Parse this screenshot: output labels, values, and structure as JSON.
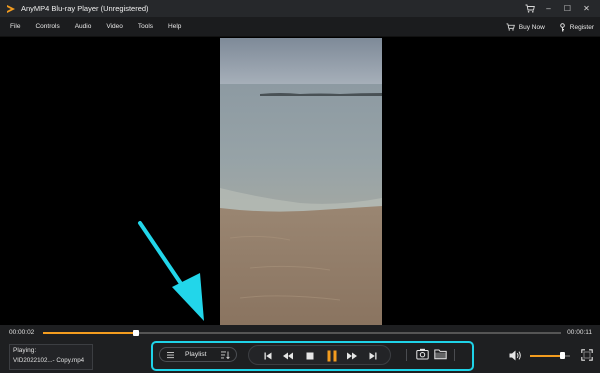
{
  "window": {
    "title": "AnyMP4 Blu-ray Player (Unregistered)",
    "minimize_symbol": "–",
    "maximize_symbol": "☐",
    "close_symbol": "✕",
    "icons": [
      "cart-icon",
      "minimize-icon",
      "maximize-icon",
      "close-icon"
    ]
  },
  "menu": {
    "items": [
      "File",
      "Controls",
      "Audio",
      "Video",
      "Tools",
      "Help"
    ],
    "buy_now": "Buy Now",
    "register": "Register"
  },
  "playback": {
    "current_time": "00:00:02",
    "total_time": "00:00:11",
    "progress_fraction": 0.18,
    "volume_fraction": 0.8
  },
  "now_playing": {
    "label": "Playing:",
    "filename": "VID2022102...- Copy.mp4"
  },
  "controls": {
    "playlist_label": "Playlist",
    "icons": [
      "playlist-icon",
      "sort-icon",
      "skip-previous-icon",
      "rewind-icon",
      "stop-icon",
      "pause-icon",
      "fast-forward-icon",
      "skip-next-icon",
      "snapshot-icon",
      "folder-icon",
      "volume-icon",
      "fullscreen-icon"
    ]
  },
  "colors": {
    "accent": "#f39c1f",
    "highlight": "#1fd3e8",
    "annotation_arrow": "#22d6ea"
  }
}
